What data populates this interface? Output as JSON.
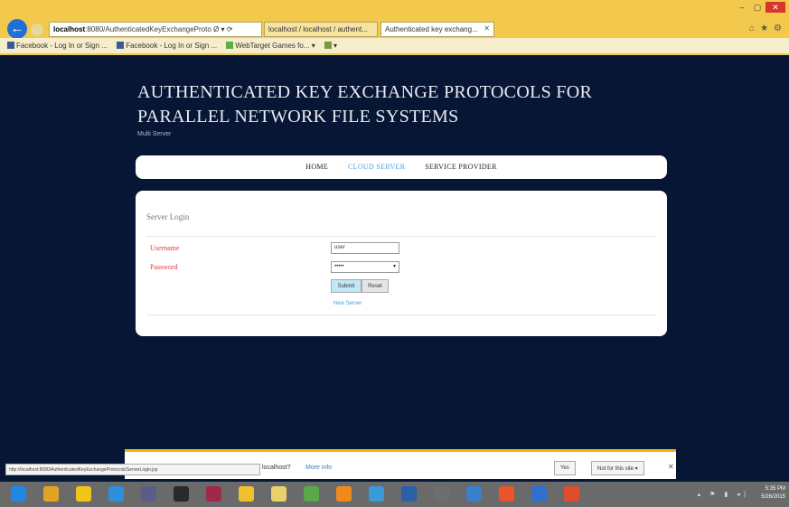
{
  "browser": {
    "address": {
      "host": "localhost",
      "rest": ":8080/AuthenticatedKeyExchangeProto"
    },
    "address_suffix": "Ø ▾ ⟳",
    "tabs": [
      {
        "label": "localhost / localhost / authent..."
      },
      {
        "label": "Authenticated key exchang..."
      }
    ],
    "window_controls": {
      "minimize": "–",
      "maximize": "▢",
      "close": "✕"
    },
    "toolbar_icons": {
      "home": "⌂",
      "favorites": "★",
      "settings": "⚙"
    },
    "favorites": [
      {
        "label": "Facebook - Log In or Sign ...",
        "color": "#3b5998"
      },
      {
        "label": "Facebook - Log In or Sign ...",
        "color": "#3b5998"
      },
      {
        "label": "WebTarget Games fo... ▾",
        "color": "#5cae3d"
      },
      {
        "label": "▾",
        "color": "#7a9a3d"
      }
    ]
  },
  "site": {
    "title": "AUTHENTICATED KEY EXCHANGE PROTOCOLS FOR PARALLEL NETWORK FILE SYSTEMS",
    "subtitle": "Multi Server"
  },
  "nav": {
    "items": [
      {
        "label": "HOME",
        "active": false
      },
      {
        "label": "CLOUD SERVER",
        "active": true
      },
      {
        "label": "SERVICE PROVIDER",
        "active": false
      }
    ]
  },
  "login": {
    "title": "Server Login",
    "username_label": "Username",
    "username_value": "user",
    "password_label": "Password",
    "password_value": "•••••",
    "select_arrow": "▾",
    "submit_label": "Submit",
    "reset_label": "Reset",
    "new_server_link": "New Server"
  },
  "notification": {
    "status_url": "http://localhost:8080/AuthenticatedKeyExchangeProtocols/ServerLogin.jsp",
    "text": "localhost?",
    "link": "More info",
    "buttons": [
      {
        "label": "Yes"
      },
      {
        "label": "Not for this site ▾"
      }
    ],
    "close": "✕"
  },
  "taskbar": {
    "tray_icons": "▴ ⚑ ▮ ◂)",
    "time": "5:35 PM",
    "date": "5/26/2015",
    "apps": [
      {
        "name": "windows-logo",
        "color": "#1e88e5"
      },
      {
        "name": "chrome",
        "color": "#e5a323"
      },
      {
        "name": "app-2",
        "color": "#f0c419"
      },
      {
        "name": "internet-explorer",
        "color": "#2f8fd8"
      },
      {
        "name": "app-4",
        "color": "#5c5c8a"
      },
      {
        "name": "app-5",
        "color": "#2a2a2a"
      },
      {
        "name": "app-6",
        "color": "#a0284b"
      },
      {
        "name": "app-7",
        "color": "#f0c030"
      },
      {
        "name": "app-8",
        "color": "#e8d16a"
      },
      {
        "name": "app-9",
        "color": "#5aa84a"
      },
      {
        "name": "vlc",
        "color": "#f08a1c"
      },
      {
        "name": "app-11",
        "color": "#3a9ad9"
      },
      {
        "name": "app-12",
        "color": "#2b5fa8"
      },
      {
        "name": "app-13",
        "color": "#6e6e6e"
      },
      {
        "name": "app-14",
        "color": "#3a7fc9"
      },
      {
        "name": "app-15",
        "color": "#e8562a"
      },
      {
        "name": "app-16",
        "color": "#2f6fd0"
      },
      {
        "name": "app-17",
        "color": "#e14d2a"
      }
    ]
  }
}
